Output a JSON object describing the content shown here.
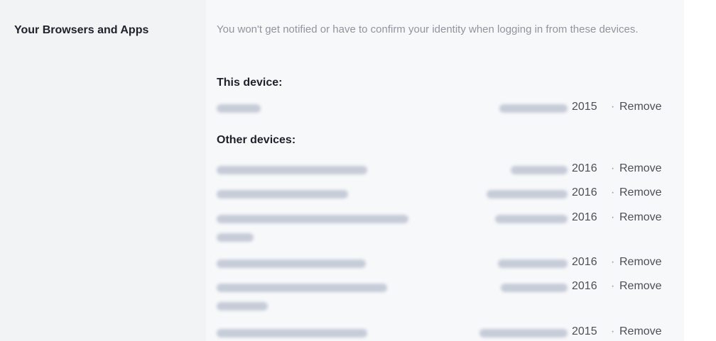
{
  "section": {
    "title": "Your Browsers and Apps",
    "description": "You won't get notified or have to confirm your identity when logging in from these devices."
  },
  "this_device": {
    "label": "This device:",
    "items": [
      {
        "year": "2015",
        "separator": "·",
        "action": "Remove"
      }
    ]
  },
  "other_devices": {
    "label": "Other devices:",
    "items": [
      {
        "year": "2016",
        "separator": "·",
        "action": "Remove"
      },
      {
        "year": "2016",
        "separator": "·",
        "action": "Remove"
      },
      {
        "year": "2016",
        "separator": "·",
        "action": "Remove"
      },
      {
        "year": "2016",
        "separator": "·",
        "action": "Remove"
      },
      {
        "year": "2016",
        "separator": "·",
        "action": "Remove"
      },
      {
        "year": "2015",
        "separator": "·",
        "action": "Remove"
      }
    ]
  },
  "colors": {
    "heading": "#1d2129",
    "muted": "#90949c",
    "blurred_text": "#c6ccd8",
    "panel_bg": "#f7f8fa"
  }
}
